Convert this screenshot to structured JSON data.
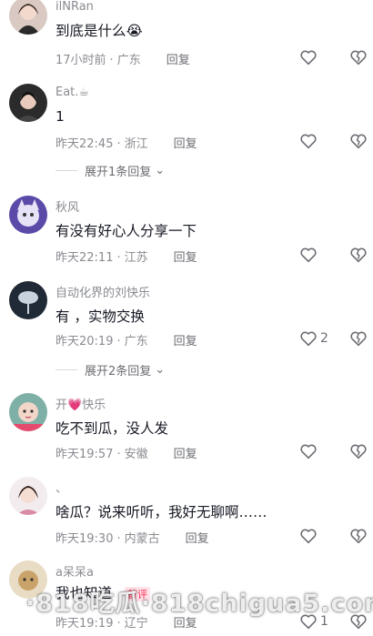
{
  "comments": [
    {
      "user": "ilNRan",
      "text": "到底是什么😭",
      "time": "17小时前",
      "location": "广东",
      "reply": "回复",
      "likes": ""
    },
    {
      "user": "Eat.☕",
      "text": "1",
      "time": "昨天22:45",
      "location": "浙江",
      "reply": "回复",
      "likes": "",
      "expand": "展开1条回复"
    },
    {
      "user": "秋风",
      "text": "有没有好心人分享一下",
      "time": "昨天22:11",
      "location": "江苏",
      "reply": "回复",
      "likes": ""
    },
    {
      "user": "自动化界的刘快乐",
      "text": "有  ，实物交换",
      "time": "昨天20:19",
      "location": "广东",
      "reply": "回复",
      "likes": "2",
      "expand": "展开2条回复"
    },
    {
      "user": "开💗快乐",
      "text": "吃不到瓜，没人发",
      "time": "昨天19:57",
      "location": "安徽",
      "reply": "回复",
      "likes": ""
    },
    {
      "user": "、",
      "text": "啥瓜？说来听听，我好无聊啊……",
      "time": "昨天19:30",
      "location": "内蒙古",
      "reply": "回复",
      "likes": ""
    },
    {
      "user": "a呆呆a",
      "text": "我也知道",
      "time": "昨天19:19",
      "location": "辽宁",
      "reply": "回复",
      "likes": "1",
      "badge": "首评"
    }
  ],
  "watermark": "·818吃瓜·818chigua5.com",
  "colors": {
    "text": "#161823",
    "meta": "#8a8b91",
    "accent": "#fe2c55"
  }
}
